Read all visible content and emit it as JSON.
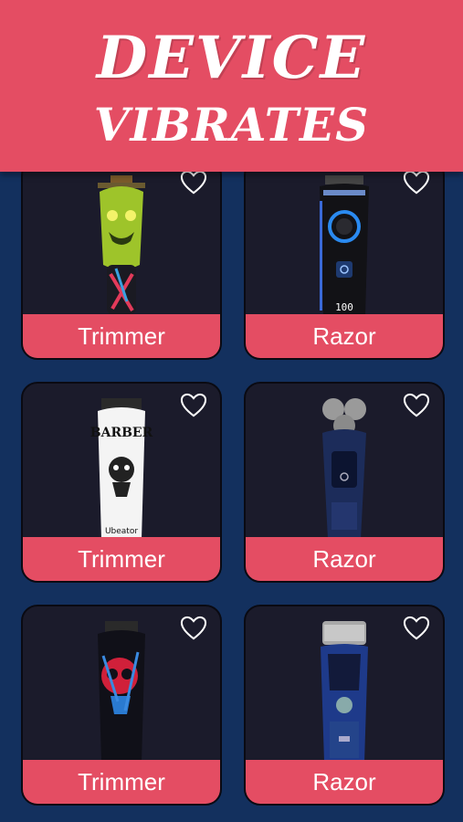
{
  "header": {
    "title_line1": "DEVICE",
    "title_line2": "VIBRATES"
  },
  "cards": [
    {
      "label": "Trimmer",
      "device": "green-monster-clipper"
    },
    {
      "label": "Razor",
      "device": "black-digital-trimmer"
    },
    {
      "label": "Trimmer",
      "device": "barber-shop-clipper"
    },
    {
      "label": "Razor",
      "device": "rotary-shaver"
    },
    {
      "label": "Trimmer",
      "device": "red-skull-clipper"
    },
    {
      "label": "Razor",
      "device": "foil-shaver"
    }
  ],
  "colors": {
    "accent": "#e44d63",
    "background": "#13305e",
    "card": "#1b1b2b"
  },
  "icons": {
    "favorite": "heart-outline-icon"
  }
}
